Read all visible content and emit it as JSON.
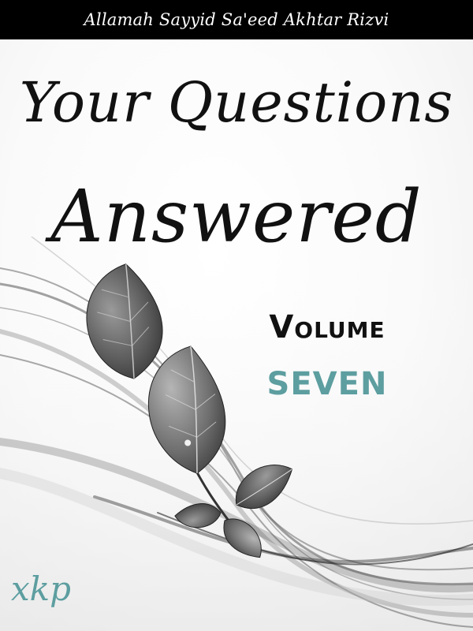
{
  "author": "Allamah Sayyid Sa'eed Akhtar Rizvi",
  "title": {
    "line1": "Your Questions",
    "line2": "Answered"
  },
  "volume": {
    "label": "Volume",
    "number": "SEVEN"
  },
  "publisher_logo": "xkp",
  "colors": {
    "author_bar": "#000000",
    "accent_teal": "#5d9ea0",
    "title_text": "#111111",
    "leaf_gray": "#6e6e6e"
  },
  "illustration": "leaves-and-flowing-swirls"
}
